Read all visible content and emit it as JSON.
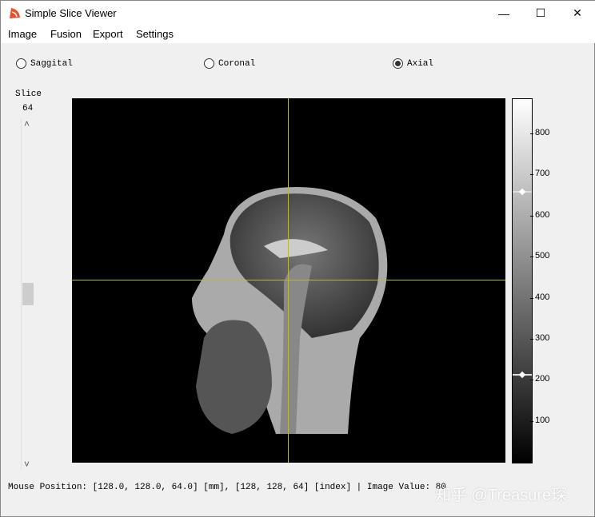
{
  "window": {
    "title": "Simple Slice Viewer",
    "minimize": "—",
    "maximize": "☐",
    "close": "✕"
  },
  "menu": [
    "Image",
    "Fusion",
    "Export",
    "Settings"
  ],
  "views": [
    {
      "label": "Saggital",
      "selected": false
    },
    {
      "label": "Coronal",
      "selected": false
    },
    {
      "label": "Axial",
      "selected": true
    }
  ],
  "slice": {
    "label": "Slice",
    "value": "64",
    "up": "˄",
    "down": "˅",
    "position_fraction": 0.5
  },
  "colorbar": {
    "ticks": [
      "800",
      "700",
      "600",
      "500",
      "400",
      "300",
      "200",
      "100"
    ],
    "tick_values": [
      800,
      700,
      600,
      500,
      400,
      300,
      200,
      100
    ],
    "window_max": 660,
    "window_min": 215
  },
  "crosshair": {
    "color": "#b5b54a"
  },
  "status": "Mouse Position: [128.0, 128.0, 64.0] [mm], [128, 128, 64] [index] | Image Value: 80",
  "watermark": "知乎 @Treasure琛"
}
